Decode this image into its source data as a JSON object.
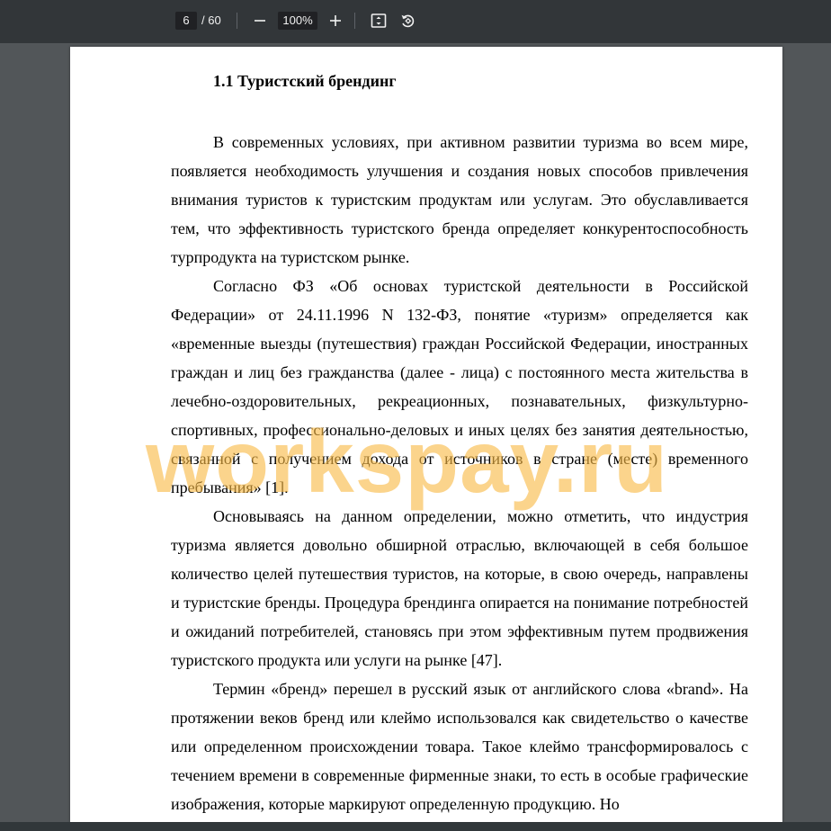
{
  "toolbar": {
    "page_current": "6",
    "page_separator": "/",
    "page_total": "60",
    "zoom_value": "100%",
    "zoom_out_icon": "minus-icon",
    "zoom_in_icon": "plus-icon",
    "fit_icon": "fit-page-icon",
    "rotate_icon": "rotate-icon"
  },
  "document": {
    "heading": "1.1 Туристский брендинг",
    "paragraphs": [
      "В современных условиях, при активном развитии туризма во всем мире, появляется необходимость улучшения и создания новых способов привлечения внимания туристов к туристским продуктам или услугам. Это обуславливается тем, что эффективность туристского бренда определяет конкурентоспособность турпродукта на туристском рынке.",
      "Согласно ФЗ «Об основах туристской деятельности в Российской Федерации» от 24.11.1996 N 132-ФЗ, понятие «туризм» определяется как «временные выезды (путешествия) граждан Российской Федерации, иностранных граждан и лиц без гражданства (далее - лица) с постоянного места жительства в лечебно-оздоровительных, рекреационных, познавательных, физкультурно-спортивных, профессионально-деловых и иных целях без занятия деятельностью, связанной с получением дохода от источников в стране (месте) временного пребывания» [1].",
      "Основываясь на данном определении, можно отметить, что индустрия туризма является довольно обширной отраслью, включающей в себя большое количество целей путешествия туристов, на которые, в свою очередь, направлены и туристские бренды. Процедура брендинга опирается на понимание потребностей и ожиданий потребителей, становясь при этом эффективным путем продвижения туристского продукта или услуги на рынке [47].",
      "Термин «бренд» перешел в русский язык от английского слова «brand». На протяжении веков бренд или клеймо использовался как свидетельство о качестве или определенном происхождении товара. Такое клеймо трансформировалось с течением времени в современные фирменные знаки, то есть в особые графические изображения, которые маркируют определенную продукцию. Но"
    ],
    "watermark": "workspay.ru"
  },
  "colors": {
    "toolbar_bg": "#323639",
    "viewer_bg": "#525659",
    "watermark": "#f8ba46"
  }
}
